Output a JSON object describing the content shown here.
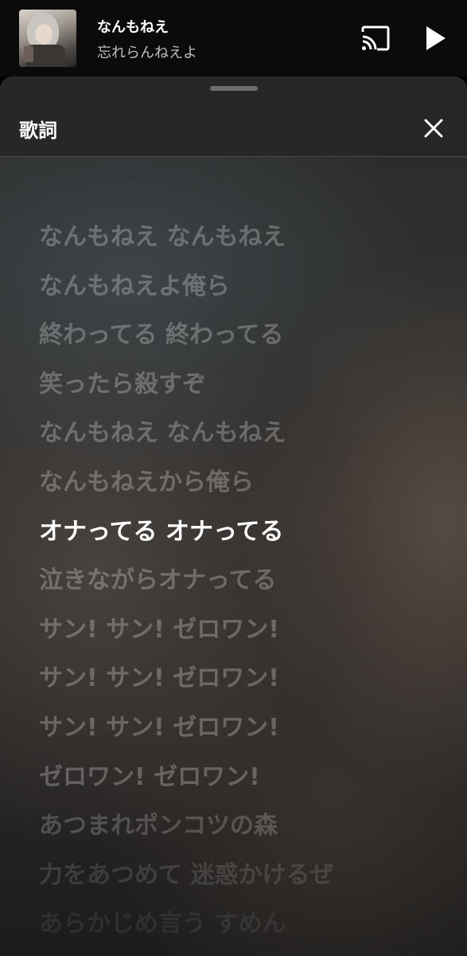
{
  "mini_player": {
    "title": "なんもねえ",
    "artist": "忘れらんねえよ",
    "cast_icon": "cast-icon",
    "play_icon": "play-icon"
  },
  "lyrics_sheet": {
    "title": "歌詞",
    "close_icon": "close-icon",
    "active_index": 6,
    "lines": [
      "なんもねえ なんもねえ",
      "なんもねえよ俺ら",
      "終わってる 終わってる",
      "笑ったら殺すぞ",
      "なんもねえ なんもねえ",
      "なんもねえから俺ら",
      "オナってる オナってる",
      "泣きながらオナってる",
      "サン! サン! ゼロワン!",
      "サン! サン! ゼロワン!",
      "サン! サン! ゼロワン!",
      "ゼロワン! ゼロワン!",
      "あつまれポンコツの森",
      "力をあつめて 迷惑かけるぜ",
      "あらかじめ言う すめん"
    ]
  },
  "colors": {
    "active_lyric": "#ffffff",
    "inactive_lyric": "rgba(255,255,255,0.26)",
    "sheet_header": "#272727",
    "mini_player_bg": "#0b0b0b"
  }
}
